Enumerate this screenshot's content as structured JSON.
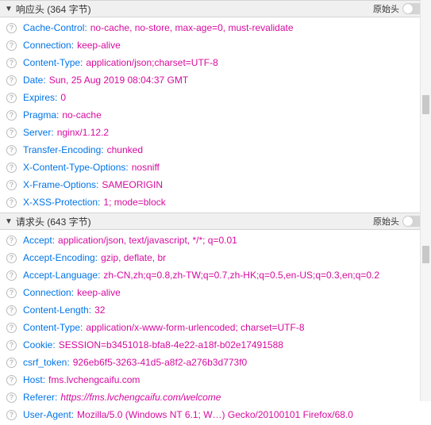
{
  "responseSection": {
    "title": "响应头 (364 字节)",
    "rawLabel": "原始头",
    "headers": [
      {
        "name": "Cache-Control",
        "value": "no-cache, no-store, max-age=0, must-revalidate"
      },
      {
        "name": "Connection",
        "value": "keep-alive"
      },
      {
        "name": "Content-Type",
        "value": "application/json;charset=UTF-8"
      },
      {
        "name": "Date",
        "value": "Sun, 25 Aug 2019 08:04:37 GMT"
      },
      {
        "name": "Expires",
        "value": "0"
      },
      {
        "name": "Pragma",
        "value": "no-cache"
      },
      {
        "name": "Server",
        "value": "nginx/1.12.2"
      },
      {
        "name": "Transfer-Encoding",
        "value": "chunked"
      },
      {
        "name": "X-Content-Type-Options",
        "value": "nosniff"
      },
      {
        "name": "X-Frame-Options",
        "value": "SAMEORIGIN"
      },
      {
        "name": "X-XSS-Protection",
        "value": "1; mode=block"
      }
    ]
  },
  "requestSection": {
    "title": "请求头 (643 字节)",
    "rawLabel": "原始头",
    "headers": [
      {
        "name": "Accept",
        "value": "application/json, text/javascript, */*; q=0.01"
      },
      {
        "name": "Accept-Encoding",
        "value": "gzip, deflate, br"
      },
      {
        "name": "Accept-Language",
        "value": "zh-CN,zh;q=0.8,zh-TW;q=0.7,zh-HK;q=0.5,en-US;q=0.3,en;q=0.2"
      },
      {
        "name": "Connection",
        "value": "keep-alive"
      },
      {
        "name": "Content-Length",
        "value": "32"
      },
      {
        "name": "Content-Type",
        "value": "application/x-www-form-urlencoded; charset=UTF-8"
      },
      {
        "name": "Cookie",
        "value": "SESSION=b3451018-bfa8-4e22-a18f-b02e17491588"
      },
      {
        "name": "csrf_token",
        "value": "926eb6f5-3263-41d5-a8f2-a276b3d773f0"
      },
      {
        "name": "Host",
        "value": "fms.lvchengcaifu.com"
      },
      {
        "name": "Referer",
        "value": "https://fms.lvchengcaifu.com/welcome",
        "italic": true
      },
      {
        "name": "User-Agent",
        "value": "Mozilla/5.0 (Windows NT 6.1; W…) Gecko/20100101 Firefox/68.0"
      }
    ]
  }
}
